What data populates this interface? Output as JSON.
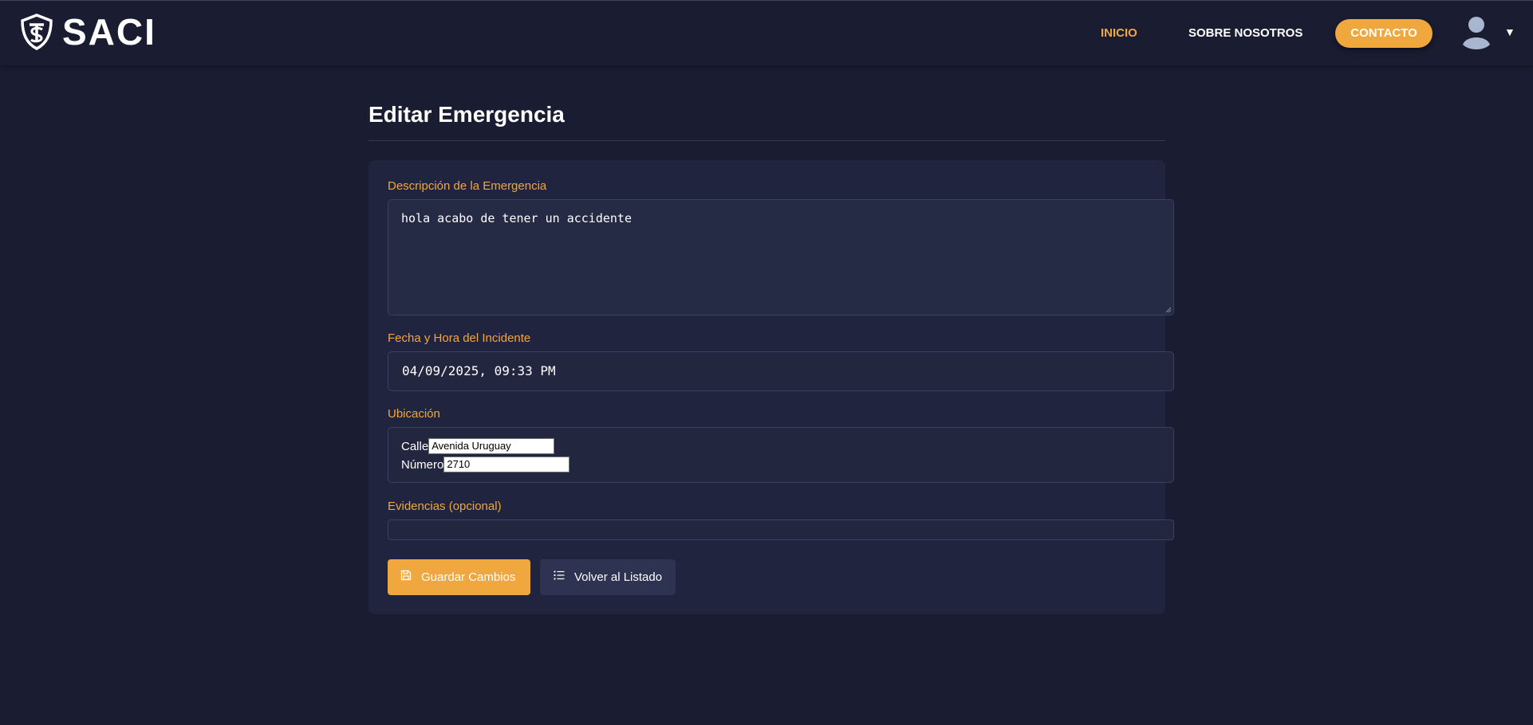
{
  "navbar": {
    "brand": "SACI",
    "links": {
      "inicio": "INICIO",
      "sobre": "SOBRE NOSOTROS",
      "contacto": "CONTACTO"
    },
    "avatar_icon": "user-avatar-icon",
    "caret": "▼"
  },
  "page": {
    "title": "Editar Emergencia"
  },
  "form": {
    "descripcion": {
      "label": "Descripción de la Emergencia",
      "value": "hola acabo de tener un accidente"
    },
    "fecha": {
      "label": "Fecha y Hora del Incidente",
      "value": "04/09/2025, 09:33 PM"
    },
    "ubicacion": {
      "label": "Ubicación",
      "calle_label": "Calle",
      "calle_value": "Avenida Uruguay",
      "numero_label": "Número",
      "numero_value": "2710"
    },
    "evidencias": {
      "label": "Evidencias (opcional)"
    }
  },
  "buttons": {
    "guardar": "Guardar Cambios",
    "volver": "Volver al Listado"
  },
  "colors": {
    "accent": "#f0a73d",
    "background": "#1a1d31",
    "card": "#20243e"
  }
}
